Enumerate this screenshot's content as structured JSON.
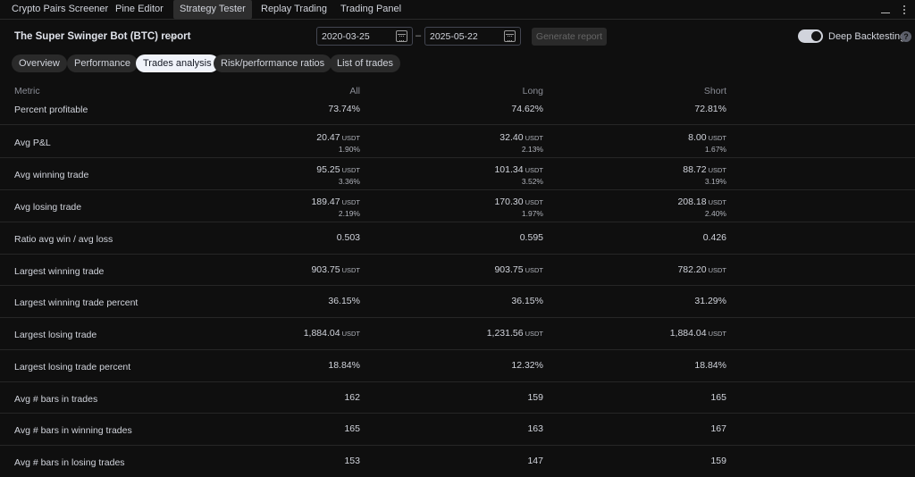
{
  "top_tabs": [
    "Crypto Pairs Screener",
    "Pine Editor",
    "Strategy Tester",
    "Replay Trading",
    "Trading Panel"
  ],
  "active_top_tab": "Strategy Tester",
  "report_title": "The Super Swinger Bot (BTC) report",
  "date_start": "2020-03-25",
  "date_dash": "–",
  "date_end": "2025-05-22",
  "generate_label": "Generate report",
  "deep_backtesting_label": "Deep Backtesting",
  "help_glyph": "?",
  "sub_tabs": [
    "Overview",
    "Performance",
    "Trades analysis",
    "Risk/performance ratios",
    "List of trades"
  ],
  "active_sub_tab": "Trades analysis",
  "columns": {
    "metric": "Metric",
    "all": "All",
    "long": "Long",
    "short": "Short"
  },
  "unit": "USDT",
  "rows": [
    {
      "metric": "Percent profitable",
      "all": "73.74%",
      "long": "74.62%",
      "short": "72.81%"
    },
    {
      "metric": "Avg P&L",
      "all": "20.47",
      "all_unit": "USDT",
      "all_pct": "1.90%",
      "long": "32.40",
      "long_unit": "USDT",
      "long_pct": "2.13%",
      "short": "8.00",
      "short_unit": "USDT",
      "short_pct": "1.67%"
    },
    {
      "metric": "Avg winning trade",
      "all": "95.25",
      "all_unit": "USDT",
      "all_pct": "3.36%",
      "long": "101.34",
      "long_unit": "USDT",
      "long_pct": "3.52%",
      "short": "88.72",
      "short_unit": "USDT",
      "short_pct": "3.19%"
    },
    {
      "metric": "Avg losing trade",
      "all": "189.47",
      "all_unit": "USDT",
      "all_pct": "2.19%",
      "long": "170.30",
      "long_unit": "USDT",
      "long_pct": "1.97%",
      "short": "208.18",
      "short_unit": "USDT",
      "short_pct": "2.40%"
    },
    {
      "metric": "Ratio avg win / avg loss",
      "all": "0.503",
      "long": "0.595",
      "short": "0.426"
    },
    {
      "metric": "Largest winning trade",
      "all": "903.75",
      "all_unit": "USDT",
      "long": "903.75",
      "long_unit": "USDT",
      "short": "782.20",
      "short_unit": "USDT"
    },
    {
      "metric": "Largest winning trade percent",
      "all": "36.15%",
      "long": "36.15%",
      "short": "31.29%"
    },
    {
      "metric": "Largest losing trade",
      "all": "1,884.04",
      "all_unit": "USDT",
      "long": "1,231.56",
      "long_unit": "USDT",
      "short": "1,884.04",
      "short_unit": "USDT"
    },
    {
      "metric": "Largest losing trade percent",
      "all": "18.84%",
      "long": "12.32%",
      "short": "18.84%"
    },
    {
      "metric": "Avg # bars in trades",
      "all": "162",
      "long": "159",
      "short": "165"
    },
    {
      "metric": "Avg # bars in winning trades",
      "all": "165",
      "long": "163",
      "short": "167"
    },
    {
      "metric": "Avg # bars in losing trades",
      "all": "153",
      "long": "147",
      "short": "159"
    }
  ]
}
